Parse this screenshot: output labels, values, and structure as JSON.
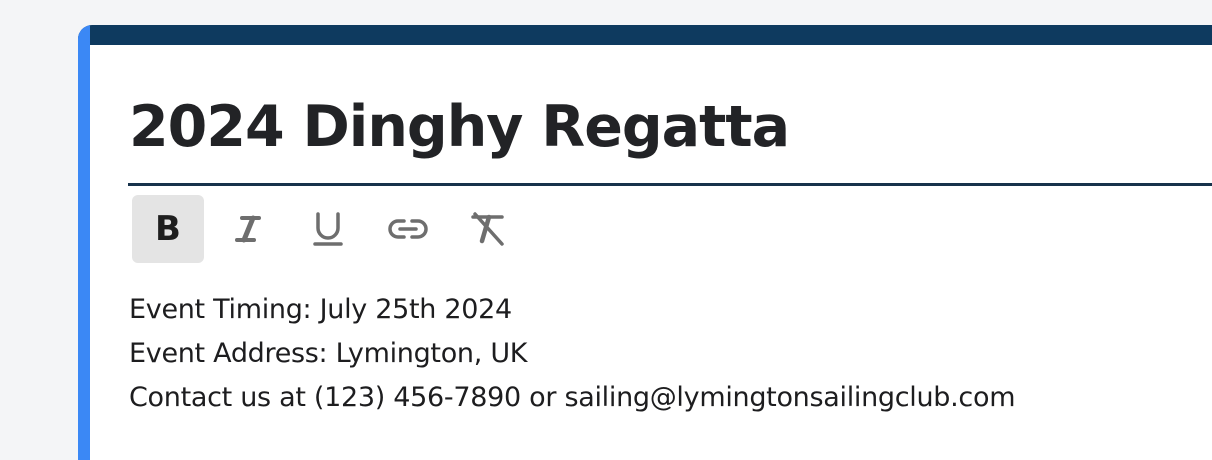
{
  "document": {
    "title": "2024 Dinghy Regatta",
    "lines": [
      "Event Timing: July 25th 2024",
      "Event Address: Lymington, UK",
      "Contact us at (123) 456-7890 or sailing@lymingtonsailingclub.com"
    ]
  },
  "toolbar": {
    "buttons": [
      {
        "name": "bold",
        "icon": "bold-icon",
        "label": "B",
        "active": true
      },
      {
        "name": "italic",
        "icon": "italic-icon",
        "active": false
      },
      {
        "name": "underline",
        "icon": "underline-icon",
        "active": false
      },
      {
        "name": "link",
        "icon": "link-icon",
        "active": false
      },
      {
        "name": "clear-format",
        "icon": "clear-format-icon",
        "active": false
      }
    ]
  },
  "colors": {
    "header_bar": "#0e3a5f",
    "accent_left": "#3b88f5",
    "title_rule": "#17324b",
    "active_button_bg": "#e4e4e4",
    "icon_gray": "#6e6e6e",
    "text": "#1d1d1f"
  }
}
